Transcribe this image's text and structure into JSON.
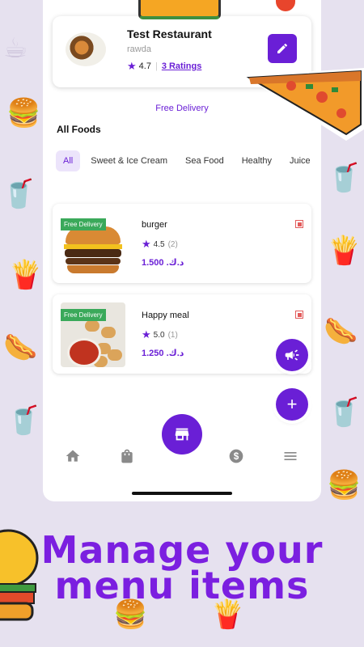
{
  "restaurant": {
    "name": "Test Restaurant",
    "subtitle": "rawda",
    "rating": "4.7",
    "ratings_link": "3 Ratings",
    "edit_icon": "pencil-icon"
  },
  "free_delivery": "Free Delivery",
  "section_title": "All Foods",
  "tabs": [
    {
      "label": "All",
      "active": true
    },
    {
      "label": "Sweet & Ice Cream",
      "active": false
    },
    {
      "label": "Sea Food",
      "active": false
    },
    {
      "label": "Healthy",
      "active": false
    },
    {
      "label": "Juice",
      "active": false
    }
  ],
  "foods": [
    {
      "name": "burger",
      "rating": "4.5",
      "count": "(2)",
      "price": "1.500 .د.ك",
      "badge": "Free Delivery"
    },
    {
      "name": "Happy meal",
      "rating": "5.0",
      "count": "(1)",
      "price": "1.250 .د.ك",
      "badge": "Free Delivery"
    }
  ],
  "fabs": {
    "announce_icon": "megaphone-icon",
    "add_icon": "plus-icon"
  },
  "nav": {
    "home_icon": "home-icon",
    "orders_icon": "bag-icon",
    "store_icon": "store-icon",
    "earnings_icon": "dollar-icon",
    "menu_icon": "hamburger-menu-icon"
  },
  "headline": {
    "line1": "Manage your",
    "line2": "menu items"
  },
  "colors": {
    "accent": "#6a1fd6",
    "headline": "#7b1fe0",
    "background": "#e6e1ef",
    "badge": "#3aa95a"
  }
}
